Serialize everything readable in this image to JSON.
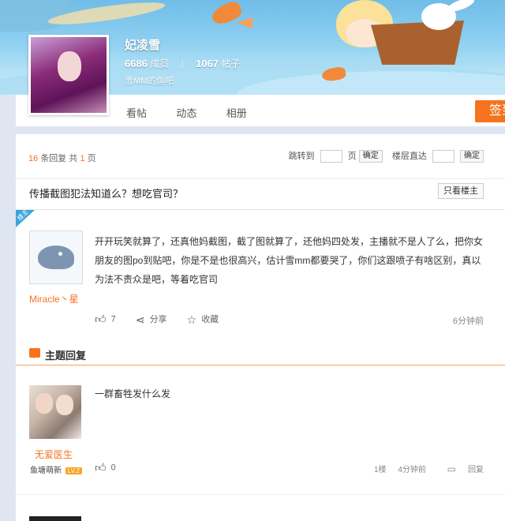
{
  "forum": {
    "name": "妃凌雪",
    "members_count": "6686",
    "members_label": "成员",
    "posts_count": "1067",
    "posts_label": "帖子",
    "slogan": "雪MM的鱼吧",
    "sign_label": "签到"
  },
  "tabs": [
    {
      "label": "看帖"
    },
    {
      "label": "动态"
    },
    {
      "label": "相册"
    }
  ],
  "pager": {
    "count": "16",
    "count_suffix": "条回复 共",
    "pages": "1",
    "pages_suffix": "页",
    "jump_label": "跳转到",
    "page_unit": "页",
    "confirm": "确定",
    "floor_label": "楼层直达",
    "confirm2": "确定"
  },
  "thread": {
    "title": "传播截图犯法知道么？想吃官司？",
    "only_op_label": "只看楼主",
    "op_badge": "楼主"
  },
  "op_post": {
    "username": "Miracle丶星",
    "content": "开开玩笑就算了，还真他妈截图，截了图就算了，还他妈四处发，主播就不是人了么，把你女朋友的图po到贴吧，你是不是也很高兴，估计雪mm都要哭了，你们这跟喷子有啥区别，真以为法不责众是吧，等着吃官司",
    "likes": "7",
    "share_label": "分享",
    "collect_label": "收藏",
    "time": "6分钟前"
  },
  "section": {
    "title": "主题回复"
  },
  "reply": {
    "username": "无爱医生",
    "badge_name": "鱼塘萌新",
    "level": "LV.2",
    "content": "一群畜牲发什么发",
    "likes": "0",
    "floor": "1楼",
    "time": "4分钟前",
    "reply_label": "回复"
  },
  "icons": {
    "like": "thumbs-up-icon",
    "share": "share-icon",
    "collect": "star-icon",
    "reply": "reply-icon",
    "comment": "chat-bubble-icon"
  },
  "colors": {
    "accent": "#f5731e",
    "op_badge": "#38a4d8"
  }
}
